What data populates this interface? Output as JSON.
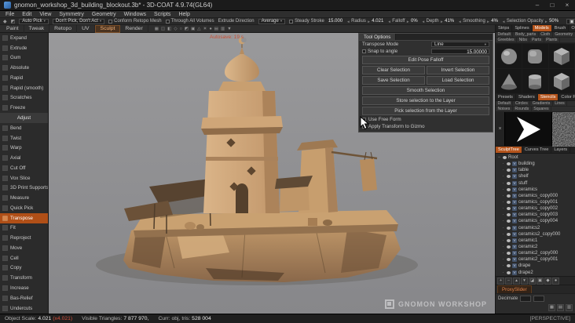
{
  "window": {
    "title": "gnomon_workshop_3d_building_blockout.3b* - 3D-COAT 4.9.74(GL64)",
    "minimize": "–",
    "maximize": "□",
    "close": "×"
  },
  "menubar": {
    "items": [
      "File",
      "Edit",
      "View",
      "Symmetry",
      "Geometry",
      "Windows",
      "Scripts",
      "Help"
    ]
  },
  "toolbar": {
    "lead_icons": [
      {
        "name": "transpose-mode-icon",
        "glyph": "◆"
      },
      {
        "name": "gizmo-mode-icon",
        "glyph": "◩"
      }
    ],
    "auto_pick": "Auto Pick",
    "dont_pick": "Don't Pick, Don't Act",
    "conform_retopo": "Conform Retopo Mesh",
    "through_all_volumes": "Through All Volumes",
    "extrude_direction_label": "Extrude Direction",
    "extrude_direction_value": "Average",
    "steady_stroke_label": "Steady Stroke",
    "steady_stroke_value": "15.000",
    "radius_label": "Radius",
    "radius_value": "4.021",
    "falloff_label": "Falloff",
    "falloff_value": "0%",
    "depth_label": "Depth",
    "depth_value": "41%",
    "smoothing_label": "Smoothing",
    "smoothing_value": "4%",
    "selection_opacity_label": "Selection Opacity",
    "selection_opacity_value": "50%",
    "camera_label": "[Camera]"
  },
  "rooms": {
    "tabs": [
      "Paint",
      "Tweak",
      "Retopo",
      "UV",
      "Sculpt",
      "Render"
    ],
    "active": "Sculpt"
  },
  "view_icons": [
    {
      "name": "grid-snap-icon",
      "glyph": "▦"
    },
    {
      "name": "symmetry-icon",
      "glyph": "◫"
    },
    {
      "name": "virtual-mirror-icon",
      "glyph": "◧"
    },
    {
      "name": "wireframe-icon",
      "glyph": "◇"
    },
    {
      "name": "ghost-mode-icon",
      "glyph": "○"
    },
    {
      "name": "isolate-icon",
      "glyph": "◩"
    },
    {
      "name": "ortho-view-icon",
      "glyph": "▣"
    },
    {
      "name": "perspective-icon",
      "glyph": "△"
    },
    {
      "name": "light-icon",
      "glyph": "☀"
    },
    {
      "name": "shadows-icon",
      "glyph": "●"
    },
    {
      "name": "background-icon",
      "glyph": "▤"
    },
    {
      "name": "render-settings-icon",
      "glyph": "▥"
    },
    {
      "name": "view-settings-icon",
      "glyph": "▼"
    }
  ],
  "left_tools": [
    {
      "label": "Expand",
      "type": "tool"
    },
    {
      "label": "Extrude",
      "type": "tool"
    },
    {
      "label": "Gum",
      "type": "tool"
    },
    {
      "label": "Absolute",
      "type": "tool"
    },
    {
      "label": "Rapid",
      "type": "tool"
    },
    {
      "label": "Rapid (smooth)",
      "type": "tool"
    },
    {
      "label": "Scratches",
      "type": "tool"
    },
    {
      "label": "Freeze",
      "type": "tool"
    },
    {
      "label": "Adjust",
      "type": "section"
    },
    {
      "label": "Bend",
      "type": "tool"
    },
    {
      "label": "Twist",
      "type": "tool"
    },
    {
      "label": "Warp",
      "type": "tool"
    },
    {
      "label": "Axial",
      "type": "tool"
    },
    {
      "label": "Cut Off",
      "type": "tool"
    },
    {
      "label": "Vox Slice",
      "type": "tool"
    },
    {
      "label": "3D Print Supports",
      "type": "tool"
    },
    {
      "label": "Measure",
      "type": "tool"
    },
    {
      "label": "Quick Pick",
      "type": "tool"
    },
    {
      "label": "Transpose",
      "type": "tool",
      "active": true
    },
    {
      "label": "Fit",
      "type": "tool"
    },
    {
      "label": "Reproject",
      "type": "tool"
    },
    {
      "label": "Move",
      "type": "tool"
    },
    {
      "label": "Cell",
      "type": "tool"
    },
    {
      "label": "Copy",
      "type": "tool"
    },
    {
      "label": "Transform",
      "type": "tool"
    },
    {
      "label": "Increase",
      "type": "tool"
    },
    {
      "label": "Bas-Relief",
      "type": "tool"
    },
    {
      "label": "Undercuts",
      "type": "tool"
    }
  ],
  "viewport": {
    "autosave": "Autosave:  19 s",
    "watermark": "GNOMON WORKSHOP"
  },
  "tool_options": {
    "title": "Tool Options",
    "transpose_mode_label": "Transpose Mode",
    "transpose_mode_value": "Line",
    "snap_label": "Snap to angle",
    "snap_value": "15.00000",
    "edit_pose_falloff": "Edit Pose Falloff",
    "clear_selection": "Clear Selection",
    "invert_selection": "Invert Selection",
    "save_selection": "Save Selection",
    "load_selection": "Load Selection",
    "smooth_selection": "Smooth Selection",
    "store_selection": "Store selection to the Layer",
    "pick_selection": "Pick selection from the Layer",
    "use_free_form": "Use Free Form",
    "apply_gizmo": "Apply Transform to Gizmo"
  },
  "right_dock": {
    "top_tabs": [
      "Strips",
      "Splines",
      "Models",
      "Brush",
      "Options"
    ],
    "top_active": "Models",
    "model_cats_row1": [
      "Default",
      "Body_parts",
      "Cloth",
      "Geometry"
    ],
    "model_cats_row2": [
      "Greebles",
      "Nibs",
      "Parts",
      "Plants"
    ],
    "model_thumbs": [
      "sphere",
      "rounded-cube",
      "cube",
      "cone",
      "cylinder",
      "box"
    ],
    "mid_tabs": [
      "Presets",
      "Shaders",
      "Stencils",
      "Color Palette"
    ],
    "mid_active": "Stencils",
    "stencil_cats_row1": [
      "Default",
      "Circles",
      "Gradients",
      "Lines"
    ],
    "stencil_cats_row2": [
      "Noises",
      "Rounds",
      "Squares"
    ],
    "stencil_close": "×",
    "tree_tabs": [
      "SculptTree",
      "Curves Tree",
      "Layers"
    ],
    "tree_active": "SculptTree",
    "tree_items": [
      {
        "name": "Root",
        "depth": 0
      },
      {
        "name": "building",
        "depth": 1
      },
      {
        "name": "table",
        "depth": 1
      },
      {
        "name": "shelf",
        "depth": 1
      },
      {
        "name": "stuff",
        "depth": 1
      },
      {
        "name": "ceramics",
        "depth": 1
      },
      {
        "name": "ceramics_copy000",
        "depth": 1
      },
      {
        "name": "ceramics_copy001",
        "depth": 1
      },
      {
        "name": "ceramics_copy002",
        "depth": 1
      },
      {
        "name": "ceramics_copy003",
        "depth": 1
      },
      {
        "name": "ceramics_copy004",
        "depth": 1
      },
      {
        "name": "ceramics2",
        "depth": 1
      },
      {
        "name": "ceramics2_copy000",
        "depth": 1
      },
      {
        "name": "ceramic1",
        "depth": 1
      },
      {
        "name": "ceramic2",
        "depth": 1
      },
      {
        "name": "ceramic2_copy000",
        "depth": 1
      },
      {
        "name": "ceramic2_copy001",
        "depth": 1
      },
      {
        "name": "drape",
        "depth": 1
      },
      {
        "name": "drape2",
        "depth": 1
      }
    ],
    "tree_toolbar_icons": [
      {
        "name": "add-volume-icon",
        "glyph": "+"
      },
      {
        "name": "delete-volume-icon",
        "glyph": "−"
      },
      {
        "name": "move-up-icon",
        "glyph": "▴"
      },
      {
        "name": "move-down-icon",
        "glyph": "▾"
      },
      {
        "name": "merge-icon",
        "glyph": "◪"
      },
      {
        "name": "duplicate-icon",
        "glyph": "▣"
      },
      {
        "name": "to-surface-icon",
        "glyph": "◆"
      },
      {
        "name": "visibility-icon",
        "glyph": "●"
      }
    ],
    "proxy_slider_label": "ProxySlider",
    "decimate_label": "Decimate",
    "bottom_icons": [
      {
        "name": "dock-grid-icon",
        "glyph": "▦"
      },
      {
        "name": "dock-list-icon",
        "glyph": "▤"
      },
      {
        "name": "dock-settings-icon",
        "glyph": "▥"
      }
    ]
  },
  "statusbar": {
    "object_scale_label": "Object Scale:",
    "object_scale_value": "4.021",
    "scale_note": "(x4.021)",
    "visible_triangles_label": "Visible Triangles:",
    "visible_triangles_value": "7 877 970,",
    "curr_label": "Curr:",
    "curr_value": "obj,",
    "tris_label": "tris:",
    "tris_value": "528 004",
    "projection": "[PERSPECTIVE]"
  },
  "colors": {
    "accent": "#b4541c",
    "clay": "#cfa678",
    "viewport_bg": "#8e8e90",
    "autosave_red": "#c94f35"
  }
}
